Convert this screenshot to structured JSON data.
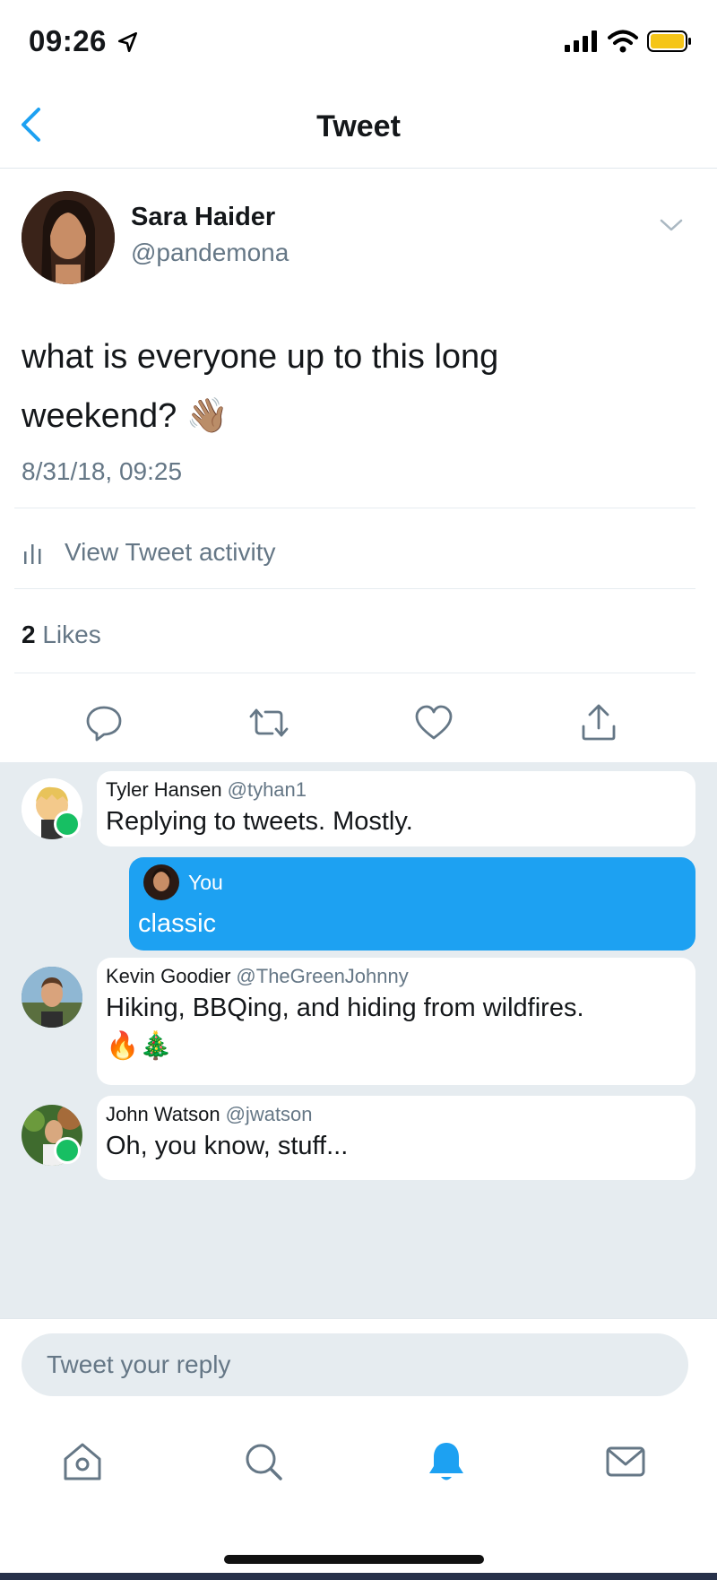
{
  "status_bar": {
    "time": "09:26",
    "icons": [
      "location-arrow-icon",
      "signal-icon",
      "wifi-icon",
      "battery-icon"
    ],
    "battery_color": "#f5c518"
  },
  "nav": {
    "title": "Tweet",
    "back_icon": "chevron-left-icon"
  },
  "tweet": {
    "author_name": "Sara Haider",
    "author_handle": "@pandemona",
    "text": "what is everyone up to this long weekend?",
    "emoji": "👋🏽",
    "timestamp": "8/31/18, 09:25",
    "activity_label": "View Tweet activity",
    "likes_count": "2",
    "likes_label": "Likes",
    "actions": [
      "reply-icon",
      "retweet-icon",
      "like-icon",
      "share-icon"
    ]
  },
  "replies": [
    {
      "name": "Tyler Hansen",
      "handle": "@tyhan1",
      "text": "Replying to tweets. Mostly.",
      "online": true
    },
    {
      "you_label": "You",
      "text": "classic"
    },
    {
      "name": "Kevin Goodier",
      "handle": "@TheGreenJohnny",
      "text": "Hiking, BBQing, and hiding from wildfires.",
      "emoji": "🔥🎄",
      "online": false
    },
    {
      "name": "John Watson",
      "handle": "@jwatson",
      "text": "Oh, you know, stuff...",
      "online": true
    }
  ],
  "composer": {
    "placeholder": "Tweet your reply"
  },
  "tabbar": {
    "tabs": [
      "home-icon",
      "search-icon",
      "notifications-icon",
      "messages-icon"
    ],
    "active_tab": "notifications-icon",
    "accent_color": "#1da1f2"
  }
}
